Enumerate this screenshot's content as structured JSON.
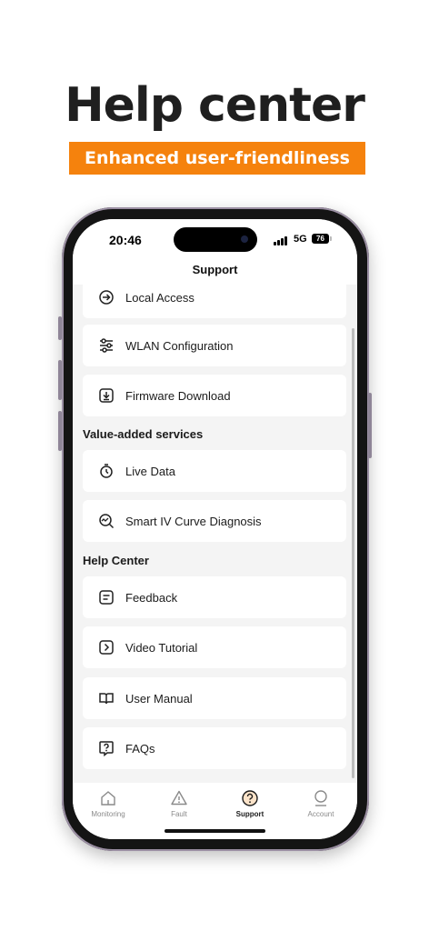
{
  "promo": {
    "headline": "Help center",
    "banner": "Enhanced user-friendliness",
    "banner_color": "#f5820d"
  },
  "status_bar": {
    "time": "20:46",
    "network": "5G",
    "battery": "76"
  },
  "nav": {
    "title": "Support"
  },
  "groups": [
    {
      "section": "",
      "items": [
        {
          "label": "Local Access",
          "icon": "login-arrow-icon"
        },
        {
          "label": "WLAN Configuration",
          "icon": "sliders-icon"
        },
        {
          "label": "Firmware Download",
          "icon": "download-icon"
        }
      ]
    },
    {
      "section": "Value-added services",
      "items": [
        {
          "label": "Live Data",
          "icon": "stopwatch-icon"
        },
        {
          "label": "Smart IV Curve Diagnosis",
          "icon": "curve-search-icon"
        }
      ]
    },
    {
      "section": "Help Center",
      "items": [
        {
          "label": "Feedback",
          "icon": "feedback-icon"
        },
        {
          "label": "Video Tutorial",
          "icon": "video-icon"
        },
        {
          "label": "User Manual",
          "icon": "book-icon"
        },
        {
          "label": "FAQs",
          "icon": "question-icon"
        }
      ]
    }
  ],
  "tabs": [
    {
      "label": "Monitoring",
      "icon": "home-icon",
      "active": false
    },
    {
      "label": "Fault",
      "icon": "warning-icon",
      "active": false
    },
    {
      "label": "Support",
      "icon": "support-icon",
      "active": true
    },
    {
      "label": "Account",
      "icon": "account-icon",
      "active": false
    }
  ],
  "colors": {
    "accent": "#f5820d",
    "background": "#f4f4f4"
  }
}
